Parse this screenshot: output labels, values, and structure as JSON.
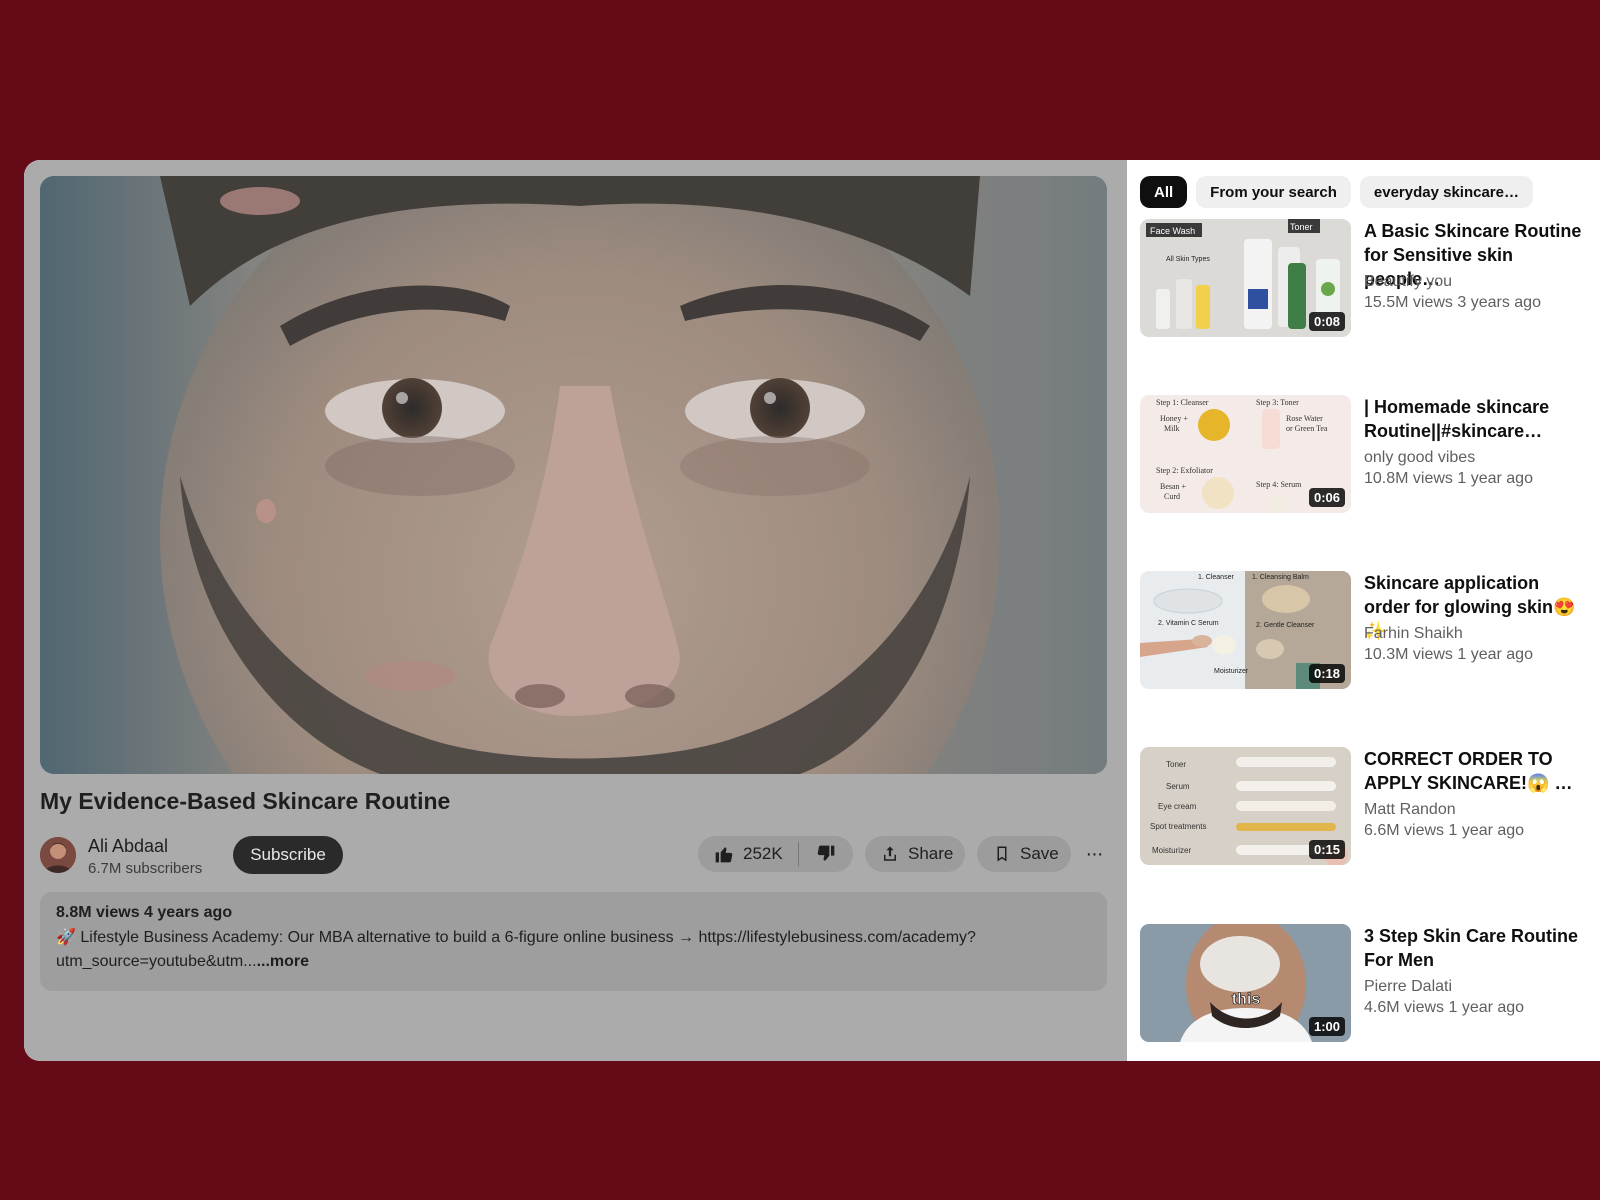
{
  "video": {
    "title": "My Evidence-Based Skincare Routine",
    "channel": "Ali Abdaal",
    "subscribers": "6.7M subscribers",
    "subscribe_label": "Subscribe",
    "likes": "252K",
    "share_label": "Share",
    "save_label": "Save",
    "more_label": "···"
  },
  "description": {
    "meta": "8.8M views  4 years ago",
    "text": "🚀 Lifestyle Business Academy: Our MBA alternative to build a 6-figure online business → https://lifestylebusiness.com/academy?utm_source=youtube&utm...",
    "more": "...more"
  },
  "chips": [
    "All",
    "From your search",
    "everyday skincare…"
  ],
  "recommendations": [
    {
      "title": "A Basic Skincare Routine for Sensitive skin people…",
      "channel": "Beautify you",
      "meta": "15.5M views  3 years ago",
      "duration": "0:08"
    },
    {
      "title": "| Homemade skincare Routine||#skincare…",
      "channel": "only good vibes",
      "meta": "10.8M views  1 year ago",
      "duration": "0:06"
    },
    {
      "title": "Skincare application order for glowing skin😍 ✨",
      "channel": "Farhin Shaikh",
      "meta": "10.3M views  1 year ago",
      "duration": "0:18"
    },
    {
      "title": "CORRECT ORDER TO APPLY SKINCARE!😱 …",
      "channel": "Matt Randon",
      "meta": "6.6M views  1 year ago",
      "duration": "0:15"
    },
    {
      "title": "3 Step Skin Care Routine For Men",
      "channel": "Pierre Dalati",
      "meta": "4.6M views  1 year ago",
      "duration": "1:00"
    }
  ],
  "thumb_text": {
    "t1": [
      "Face Wash",
      "Toner",
      "All Skin Types"
    ],
    "t2": [
      "Step 1: Cleanser",
      "Step 3: Toner",
      "Honey +",
      "Milk",
      "Rose Water",
      "or Green Tea",
      "Step 2: Exfoliator",
      "Step 4: Serum",
      "Besan +",
      "Curd"
    ],
    "t3": [
      "1. Cleanser",
      "1. Cleansing Balm",
      "2. Vitamin C Serum",
      "2. Gentle Cleanser",
      "Moisturizer"
    ],
    "t4": [
      "Toner",
      "Serum",
      "Eye cream",
      "Spot treatments",
      "Moisturizer"
    ],
    "t5": [
      "this"
    ]
  }
}
